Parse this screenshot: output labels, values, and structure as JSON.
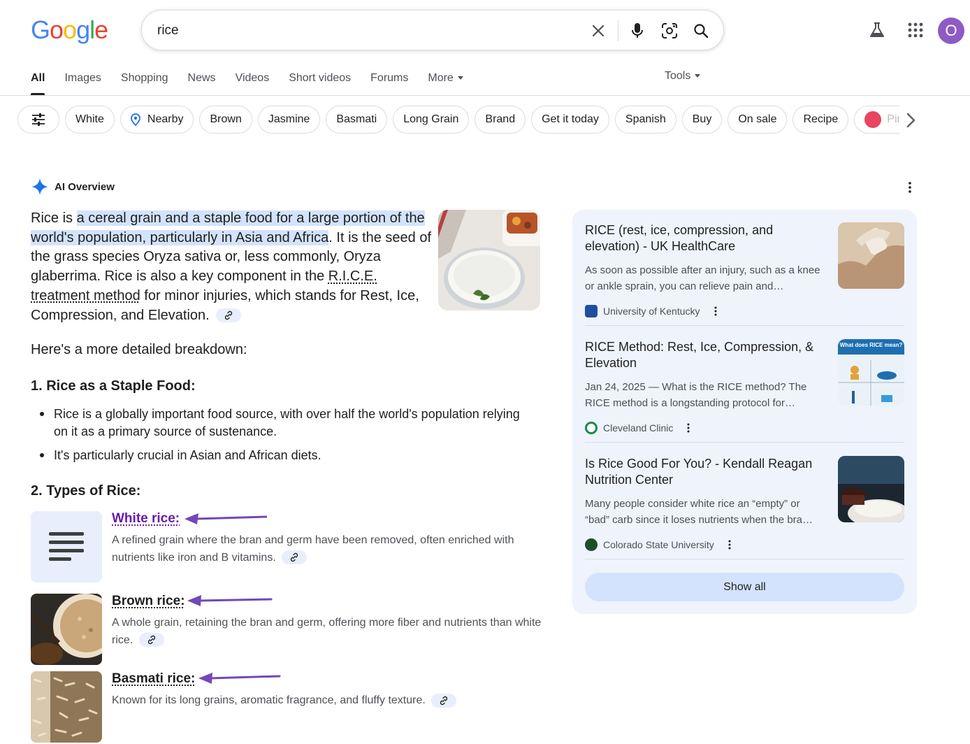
{
  "header": {
    "logo_letters": [
      "G",
      "o",
      "o",
      "g",
      "l",
      "e"
    ],
    "logo_colors": [
      "#4285F4",
      "#EA4335",
      "#FBBC05",
      "#4285F4",
      "#34A853",
      "#EA4335"
    ],
    "search_value": "rice",
    "avatar_letter": "O",
    "icons": [
      "close-icon",
      "mic-icon",
      "lens-icon",
      "search-icon",
      "labs-icon",
      "apps-icon"
    ]
  },
  "tabs": {
    "items": [
      "All",
      "Images",
      "Shopping",
      "News",
      "Videos",
      "Short videos",
      "Forums",
      "More"
    ],
    "active": "All",
    "tools_label": "Tools"
  },
  "chips": [
    "White",
    "Nearby",
    "Brown",
    "Jasmine",
    "Basmati",
    "Long Grain",
    "Brand",
    "Get it today",
    "Spanish",
    "Buy",
    "On sale",
    "Recipe",
    "Pink"
  ],
  "ai_overview": {
    "title": "AI Overview",
    "intro_before": "Rice is ",
    "intro_highlight": "a cereal grain and a staple food for a large portion of the world's population, particularly in Asia and Africa",
    "intro_mid": ". It is the seed of the grass species Oryza sativa or, less commonly, Oryza glaberrima. Rice is also a key component in the ",
    "intro_link": "R.I.C.E. treatment method",
    "intro_after": " for minor injuries, which stands for Rest, Ice, Compression, and Elevation.",
    "breakdown": "Here's a more detailed breakdown:",
    "section1_title": "1. Rice as a Staple Food:",
    "section1_bullets": [
      "Rice is a globally important food source, with over half the world's population relying on it as a primary source of sustenance.",
      "It's particularly crucial in Asian and African diets."
    ],
    "section2_title": "2. Types of Rice:",
    "types": [
      {
        "name": "White rice:",
        "desc": "A refined grain where the bran and germ have been removed, often enriched with nutrients like iron and B vitamins."
      },
      {
        "name": "Brown rice:",
        "desc": "A whole grain, retaining the bran and germ, offering more fiber and nutrients than white rice."
      },
      {
        "name": "Basmati rice:",
        "desc": "Known for its long grains, aromatic fragrance, and fluffy texture."
      }
    ]
  },
  "sources": [
    {
      "title": "RICE (rest, ice, compression, and elevation) - UK HealthCare",
      "snippet": "As soon as possible after an injury, such as a knee or ankle sprain, you can relieve pain and…",
      "site": "University of Kentucky"
    },
    {
      "title": "RICE Method: Rest, Ice, Compression, & Elevation",
      "snippet": "Jan 24, 2025 — What is the RICE method? The RICE method is a longstanding protocol for…",
      "site": "Cleveland Clinic",
      "thumb_text": "What does RICE mean?"
    },
    {
      "title": "Is Rice Good For You? - Kendall Reagan Nutrition Center",
      "snippet": "Many people consider white rice an “empty” or “bad” carb since it loses nutrients when the bra…",
      "site": "Colorado State University"
    }
  ],
  "show_all_label": "Show all",
  "colors": {
    "accent_purple": "#7248b9",
    "highlight": "#d3e3fd",
    "panel_bg": "#eef3fc",
    "white_rice_link": "#681da8"
  }
}
